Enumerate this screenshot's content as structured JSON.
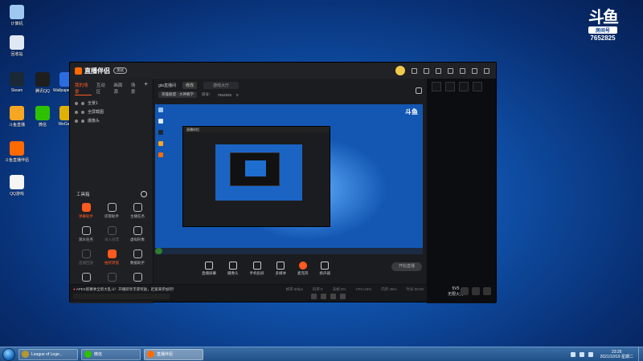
{
  "desktop": {
    "icons": [
      {
        "label": "计算机",
        "color": "#9ec8f0"
      },
      {
        "label": "回收站",
        "color": "#dfe9f5"
      },
      {
        "label": "Steam",
        "color": "#1b2838"
      },
      {
        "label": "腾讯QQ",
        "color": "#1e1e1e"
      },
      {
        "label": "Wallpaper Engine",
        "color": "#2d6cdf"
      },
      {
        "label": "斗鱼直播",
        "color": "#f6a623"
      },
      {
        "label": "微信",
        "color": "#2dc100"
      },
      {
        "label": "WeGame",
        "color": "#e0b000"
      },
      {
        "label": "斗鱼直播伴侣",
        "color": "#ff6a00"
      },
      {
        "label": "QQ游戏",
        "color": "#f5f5f5"
      }
    ]
  },
  "room": {
    "logo": "斗鱼",
    "tag": "房间号",
    "number": "7652825"
  },
  "app": {
    "name": "直播伴侣",
    "version": "测试",
    "tabs": [
      "我的场景",
      "互动区",
      "画面源",
      "场景"
    ],
    "scenes": [
      "全景1",
      "全屏截图",
      "摄像头"
    ],
    "tools_title": "工具箱",
    "tools": [
      {
        "label": "弹幕助手",
        "hot": true
      },
      {
        "label": "房管助手",
        "hot": false
      },
      {
        "label": "主播任务",
        "hot": false
      },
      {
        "label": "观众任务",
        "hot": false
      },
      {
        "label": "录入投票",
        "hot": false,
        "dim": true
      },
      {
        "label": "虚拟形象",
        "hot": false
      },
      {
        "label": "直播回放",
        "hot": false,
        "dim": true
      },
      {
        "label": "抽奖转盘",
        "hot": true
      },
      {
        "label": "数据助手",
        "hot": false
      },
      {
        "label": "连麦PK",
        "hot": false
      },
      {
        "label": "优化直播",
        "hot": false,
        "dim": true
      },
      {
        "label": "一键下载",
        "hot": false
      }
    ],
    "info": {
      "room_label": "gta直播间",
      "edit_btn": "修改",
      "title_placeholder": "游戏大厅",
      "category": "英雄联盟",
      "area": "大神教学",
      "room_id_label": "房号：",
      "room_id": "7652825",
      "fans": "0"
    },
    "bottom": [
      {
        "label": "直播屏幕",
        "type": "normal"
      },
      {
        "label": "摄像头",
        "type": "normal"
      },
      {
        "label": "手机投屏",
        "type": "normal"
      },
      {
        "label": "多媒体",
        "type": "normal"
      },
      {
        "label": "麦克风",
        "type": "mic"
      },
      {
        "label": "扬声器",
        "type": "normal"
      }
    ],
    "start_label": "开始直播",
    "notice_prefix": "APEX新赛季",
    "notice": "APEX新赛季全新大乱斗！开播即享丰厚奖励，赶紧来参加吧！",
    "stats": [
      "帧率:60fps",
      "码率:0",
      "丢帧:0%",
      "CPU:19%",
      "内存:45%",
      "时长:00:00"
    ],
    "pk_line1": "5V5",
    "pk_line2": "无限火力"
  },
  "taskbar": {
    "buttons": [
      {
        "label": "League of Lege...",
        "color": "#b8962e"
      },
      {
        "label": "微信",
        "color": "#2dc100"
      },
      {
        "label": "直播伴侣",
        "color": "#ff6a00"
      }
    ],
    "time": "23:26",
    "date": "2021/10/19 星期二"
  }
}
